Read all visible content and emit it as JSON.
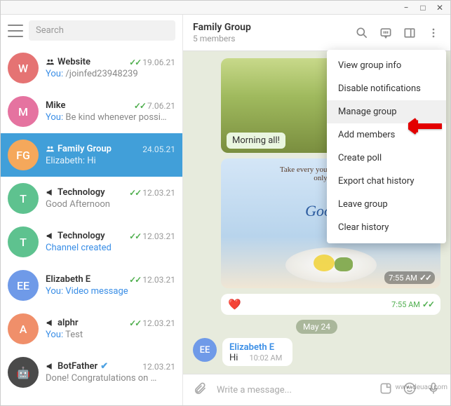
{
  "window": {
    "min": "−",
    "max": "□",
    "close": "✕"
  },
  "search_placeholder": "Search",
  "header": {
    "title": "Family Group",
    "subtitle": "5 members"
  },
  "chats": [
    {
      "avatar": "W",
      "color": "#e57373",
      "name": "Website",
      "icon": "group",
      "time": "19.06.21",
      "checks": true,
      "preview_label": "You:",
      "preview": "/joinfed23948239"
    },
    {
      "avatar": "M",
      "color": "#e573a0",
      "name": "Mike",
      "time": "7.06.21",
      "checks": true,
      "preview_label": "You:",
      "preview": "Be kind whenever possi…"
    },
    {
      "avatar": "FG",
      "color": "#f5a85b",
      "name": "Family Group",
      "icon": "group",
      "time": "24.05.21",
      "selected": true,
      "preview_label": "Elizabeth:",
      "preview": "Hi"
    },
    {
      "avatar": "T",
      "color": "#5ec28f",
      "name": "Technology",
      "icon": "megaphone",
      "time": "12.03.21",
      "checks": true,
      "preview_label": "",
      "preview": "Good Afternoon"
    },
    {
      "avatar": "T",
      "color": "#5ec28f",
      "name": "Technology",
      "icon": "megaphone",
      "time": "12.03.21",
      "checks": true,
      "preview_label": "",
      "preview": "Channel created",
      "preview_accent": true
    },
    {
      "avatar": "EE",
      "color": "#6f9ae8",
      "name": "Elizabeth E",
      "time": "12.03.21",
      "checks": true,
      "preview_label": "You:",
      "preview": "Video message",
      "preview_accent": true
    },
    {
      "avatar": "A",
      "color": "#f08f6a",
      "name": "alphr",
      "icon": "megaphone",
      "time": "12.03.21",
      "checks": true,
      "preview_label": "You:",
      "preview": "Test"
    },
    {
      "avatar": "🤖",
      "color": "#4a4a4a",
      "name": "BotFather",
      "icon": "megaphone",
      "verified": true,
      "time": "12.03.21",
      "preview_label": "",
      "preview": "Done! Congratulations on …"
    }
  ],
  "menu": {
    "items": [
      "View group info",
      "Disable notifications",
      "Manage group",
      "Add members",
      "Create poll",
      "Export chat history",
      "Leave group",
      "Clear history"
    ],
    "highlighted_index": 2
  },
  "msg1": {
    "caption": "Morning all!"
  },
  "msg2": {
    "quote": "Take every\nyou get i\nbecause son\nonly happe",
    "title": "Good M",
    "time": "7:55 AM"
  },
  "reaction": {
    "emoji": "❤️",
    "time": "7:55 AM"
  },
  "date_separator": "May 24",
  "own_message": {
    "avatar": "EE",
    "sender": "Elizabeth E",
    "text": "Hi",
    "time": "10:02 AM"
  },
  "composer_placeholder": "Write a message...",
  "watermark": "www.deuaq.com"
}
